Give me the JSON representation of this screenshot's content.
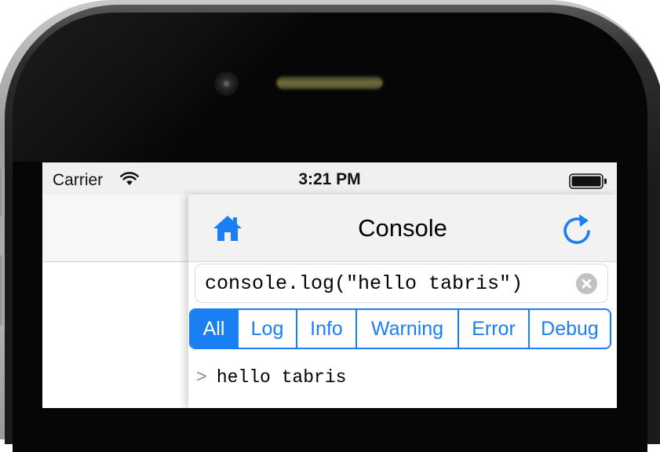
{
  "status_bar": {
    "carrier": "Carrier",
    "time": "3:21 PM",
    "wifi_icon": "wifi-icon",
    "battery_icon": "battery-icon"
  },
  "console": {
    "title": "Console",
    "home_icon": "home-icon",
    "refresh_icon": "refresh-icon",
    "input": {
      "value": "console.log(\"hello tabris\")",
      "clear_icon": "clear-icon"
    },
    "filters": [
      {
        "label": "All",
        "active": true
      },
      {
        "label": "Log",
        "active": false
      },
      {
        "label": "Info",
        "active": false
      },
      {
        "label": "Warning",
        "active": false
      },
      {
        "label": "Error",
        "active": false
      },
      {
        "label": "Debug",
        "active": false
      }
    ],
    "log": [
      {
        "prompt": ">",
        "text": "hello tabris"
      }
    ]
  },
  "colors": {
    "accent": "#1a7ff2",
    "navbar": "#f2f2f3",
    "status_bar": "#f0f0f2"
  }
}
